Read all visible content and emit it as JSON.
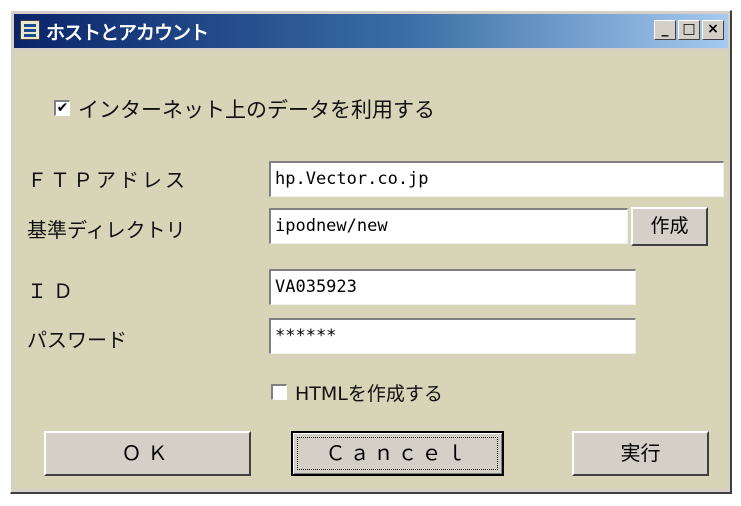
{
  "window": {
    "title": "ホストとアカウント",
    "controls": {
      "minimize": "_",
      "maximize": "□",
      "close": "×"
    }
  },
  "use_internet": {
    "checked": true,
    "check_glyph": "✔",
    "label": "インターネット上のデータを利用する"
  },
  "ftp": {
    "label": "ＦＴＰアドレス",
    "value": "hp.Vector.co.jp"
  },
  "basedir": {
    "label": "基準ディレクトリ",
    "value": "ipodnew/new",
    "create_button": "作成"
  },
  "id": {
    "label": "ＩＤ",
    "value": "VA035923"
  },
  "password": {
    "label": "パスワード",
    "value": "******"
  },
  "html_option": {
    "checked": false,
    "label": "HTMLを作成する"
  },
  "buttons": {
    "ok": "ＯＫ",
    "cancel": "Ｃａｎｃｅｌ",
    "run": "実行"
  }
}
